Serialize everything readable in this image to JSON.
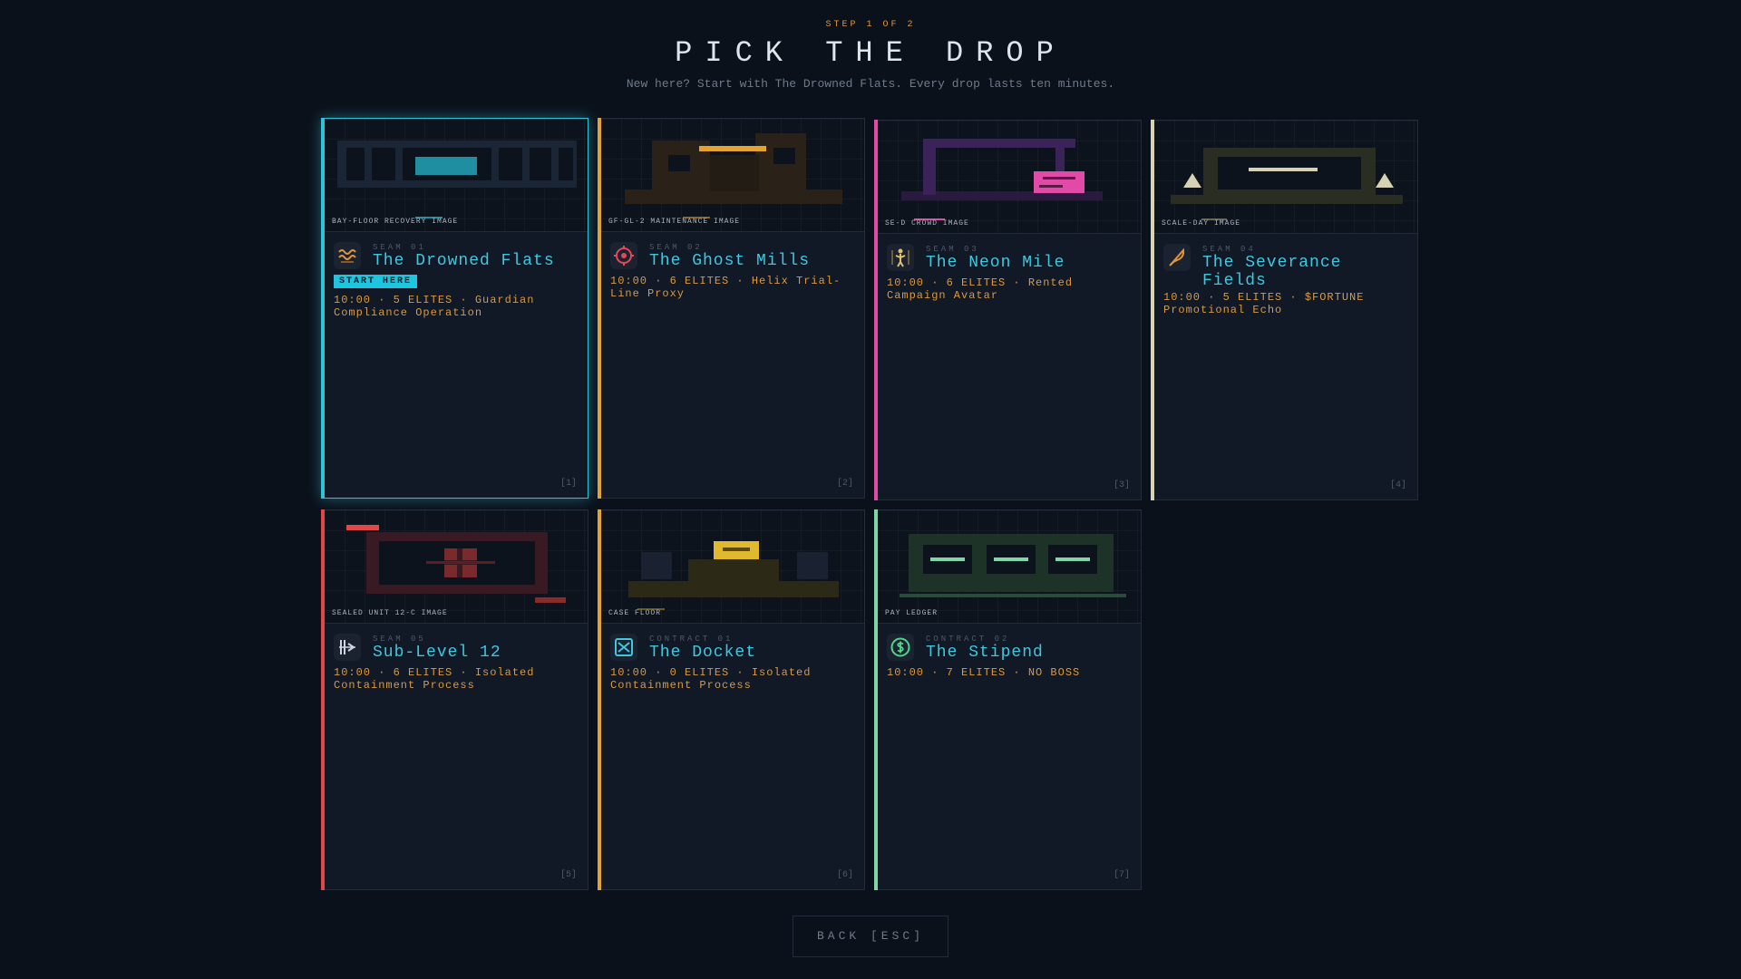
{
  "header": {
    "step": "STEP 1 OF 2",
    "title": "PICK THE DROP",
    "subtitle": "New here? Start with The Drowned Flats. Every drop lasts ten minutes."
  },
  "cards": [
    {
      "art_label": "BAY-FLOOR RECOVERY IMAGE",
      "seam": "SEAM 01",
      "name": "The Drowned Flats",
      "badge": "START HERE",
      "meta": "10:00 · 5 ELITES · Guardian Compliance Operation",
      "index": "[1]",
      "accent": "#2fc3d8",
      "icon": "wave-icon"
    },
    {
      "art_label": "GF-GL-2 MAINTENANCE IMAGE",
      "seam": "SEAM 02",
      "name": "The Ghost Mills",
      "meta": "10:00 · 6 ELITES · Helix Trial-Line Proxy",
      "index": "[2]",
      "accent": "#e3a332",
      "icon": "target-icon"
    },
    {
      "art_label": "SE-D CROWD IMAGE",
      "seam": "SEAM 03",
      "name": "The Neon Mile",
      "meta": "10:00 · 6 ELITES · Rented Campaign Avatar",
      "index": "[3]",
      "accent": "#e24aa8",
      "icon": "figure-icon"
    },
    {
      "art_label": "SCALE-DAY IMAGE",
      "seam": "SEAM 04",
      "name": "The Severance Fields",
      "meta": "10:00 · 5 ELITES · $FORTUNE Promotional Echo",
      "index": "[4]",
      "accent": "#d8d2b4",
      "icon": "quill-icon"
    },
    {
      "art_label": "SEALED UNIT 12-C IMAGE",
      "seam": "SEAM 05",
      "name": "Sub-Level 12",
      "meta": "10:00 · 6 ELITES · Isolated Containment Process",
      "index": "[5]",
      "accent": "#e04848",
      "icon": "barrier-icon"
    },
    {
      "art_label": "CASE FLOOR",
      "seam": "CONTRACT 01",
      "name": "The Docket",
      "meta": "10:00 · 0 ELITES · Isolated Containment Process",
      "index": "[6]",
      "accent": "#e3a332",
      "icon": "envelope-icon"
    },
    {
      "art_label": "PAY LEDGER",
      "seam": "CONTRACT 02",
      "name": "The Stipend",
      "meta": "10:00 · 7 ELITES · NO BOSS",
      "index": "[7]",
      "accent": "#7fd6a6",
      "icon": "dollar-icon"
    }
  ],
  "back_label": "BACK [ESC]"
}
